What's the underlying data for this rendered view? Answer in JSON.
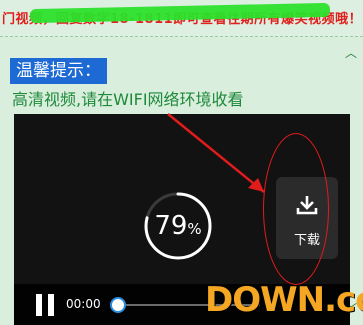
{
  "banner": {
    "text": "门视频，回复数字18-1811即可查看往期所有爆笑视频哦！"
  },
  "hint": {
    "label": "温馨提示：",
    "subtitle": "高清视频,请在WIFI网络环境收看"
  },
  "player": {
    "progress_percent": 79,
    "progress_text": "79",
    "percent_sign": "%",
    "download_label": "下载",
    "time": "00:00"
  },
  "watermark": {
    "text": "DOWN.cc"
  },
  "colors": {
    "banner_text": "#e0201c",
    "highlight": "#2be02b",
    "hint_bg": "#1d6ad4",
    "subtitle": "#1f8a3a",
    "annotation": "#e21b1b"
  }
}
